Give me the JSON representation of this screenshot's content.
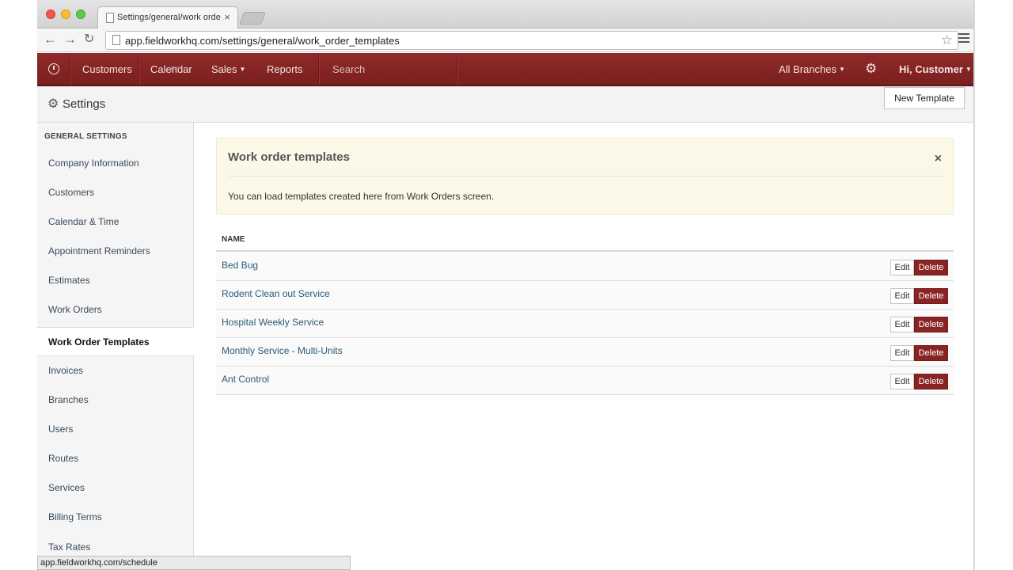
{
  "browser": {
    "tab_title": "Settings/general/work orde",
    "tab_close": "×",
    "url": "app.fieldworkhq.com/settings/general/work_order_templates",
    "status_url": "app.fieldworkhq.com/schedule"
  },
  "navbar": {
    "items": {
      "customers": "Customers",
      "calendar": "Calendar",
      "sales": "Sales",
      "reports": "Reports"
    },
    "search_placeholder": "Search",
    "branches": "All Branches",
    "greeting": "Hi, Customer"
  },
  "header": {
    "title": "Settings",
    "new_template": "New Template"
  },
  "sidebar": {
    "heading": "GENERAL SETTINGS",
    "items": [
      "Company Information",
      "Customers",
      "Calendar & Time",
      "Appointment Reminders",
      "Estimates",
      "Work Orders",
      "Work Order Templates",
      "Invoices",
      "Branches",
      "Users",
      "Routes",
      "Services",
      "Billing Terms",
      "Tax Rates"
    ],
    "active_index": 6
  },
  "alert": {
    "title": "Work order templates",
    "message": "You can load templates created here from Work Orders screen.",
    "close": "×"
  },
  "table": {
    "header": "NAME",
    "edit_label": "Edit",
    "delete_label": "Delete",
    "rows": [
      "Bed Bug",
      "Rodent Clean out Service",
      "Hospital Weekly Service",
      "Monthly Service - Multi-Units",
      "Ant Control"
    ]
  },
  "colors": {
    "navbar": "#8a2424",
    "delete_button": "#8a2424",
    "alert_bg": "#fbf8e8",
    "link": "#2b5a7a"
  }
}
